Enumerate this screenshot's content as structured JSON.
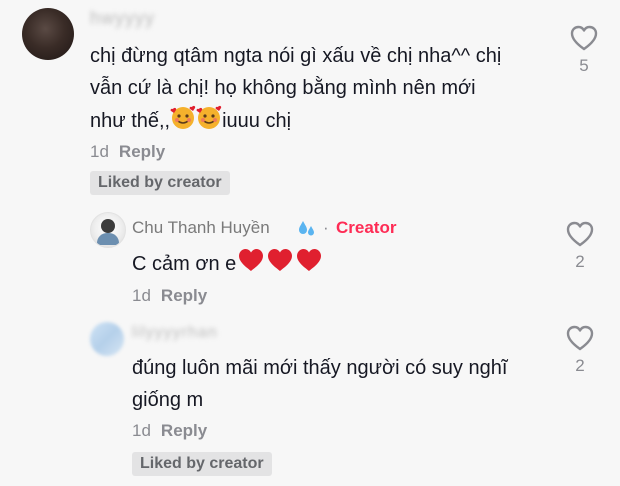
{
  "comments": [
    {
      "username": "hwyyyy",
      "text_lines": [
        "chị đừng qtâm ngta nói gì xấu về chị nha^^ chị",
        "vẫn cứ là chị! họ không bằng mình nên mới",
        "như thế,,",
        "iuuu chị"
      ],
      "emoji": "smiling-face-with-hearts",
      "time": "1d",
      "reply_label": "Reply",
      "liked_badge": "Liked by creator",
      "like_count": "5"
    },
    {
      "username": "Chu Thanh Huyền",
      "username_emoji": "sweat-droplets",
      "separator": "·",
      "creator_label": "Creator",
      "text": "C cảm ơn e",
      "emoji": "red-heart",
      "time": "1d",
      "reply_label": "Reply",
      "like_count": "2"
    },
    {
      "username": "lilyyyyrhan",
      "text_lines": [
        "đúng luôn mãi mới thấy người có suy nghĩ",
        "giống m"
      ],
      "time": "1d",
      "reply_label": "Reply",
      "liked_badge": "Liked by creator",
      "like_count": "2"
    }
  ],
  "colors": {
    "background": "#f7f7f7",
    "creator": "#fe2c55",
    "meta": "#8a8b91",
    "heart_emoji": "#e0202f"
  }
}
